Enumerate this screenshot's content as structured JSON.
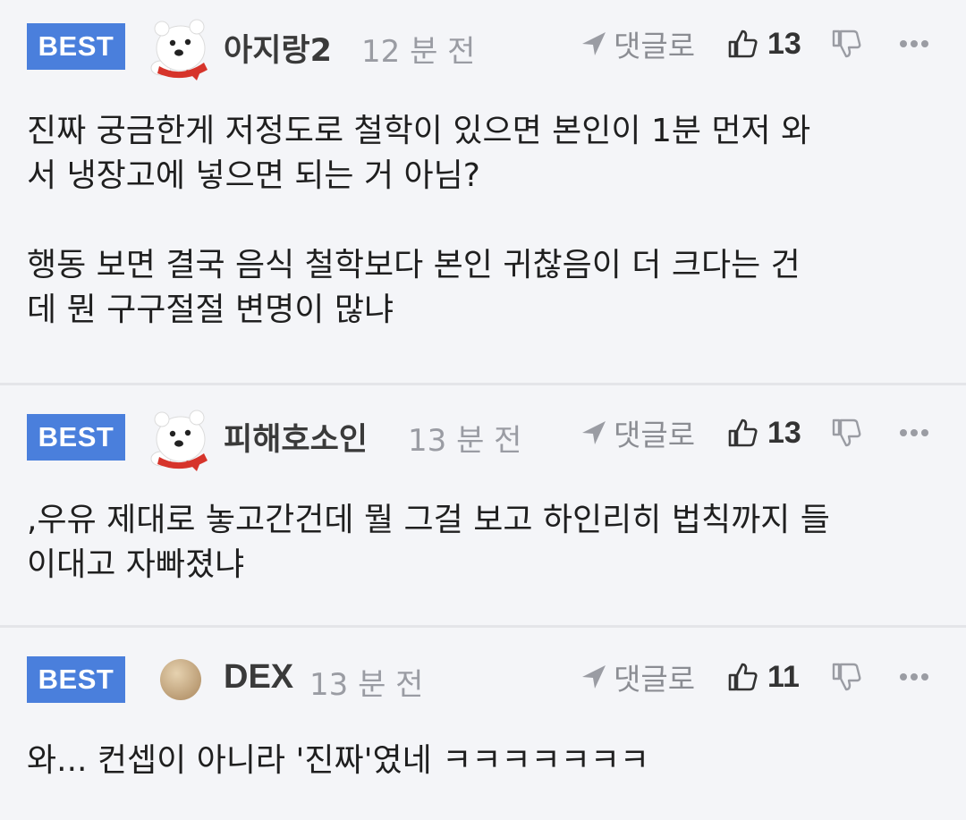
{
  "comments": [
    {
      "badge": "BEST",
      "author": "아지랑2",
      "time": "12 분 전",
      "reply_label": "댓글로",
      "likes": "13",
      "avatar": "polar-bear",
      "paragraphs": [
        "진짜 궁금한게 저정도로 철학이 있으면 본인이 1분 먼저 와\n서 냉장고에 넣으면 되는 거 아님?",
        "행동 보면 결국 음식 철학보다 본인 귀찮음이 더 크다는 건\n데 뭔 구구절절 변명이 많냐"
      ]
    },
    {
      "badge": "BEST",
      "author": "피해호소인",
      "time": "13 분 전",
      "reply_label": "댓글로",
      "likes": "13",
      "avatar": "polar-bear",
      "paragraphs": [
        ",우유 제대로 놓고간건데 뭘 그걸 보고 하인리히 법칙까지 들\n이대고 자빠졌냐"
      ]
    },
    {
      "badge": "BEST",
      "author": "DEX",
      "time": "13 분 전",
      "reply_label": "댓글로",
      "likes": "11",
      "avatar": "beige-circle",
      "paragraphs": [
        "와... 컨셉이 아니라 '진짜'였네 ㅋㅋㅋㅋㅋㅋㅋ"
      ]
    }
  ],
  "colors": {
    "badge": "#4a7fdc",
    "background": "#f4f5f8",
    "divider": "#e4e5e9",
    "meta_text": "#9a9ca3"
  },
  "icons": [
    "polar-bear-avatar",
    "beige-circle-avatar",
    "reply-arrow-icon",
    "thumbs-up-icon",
    "thumbs-down-icon",
    "more-dots-icon"
  ]
}
